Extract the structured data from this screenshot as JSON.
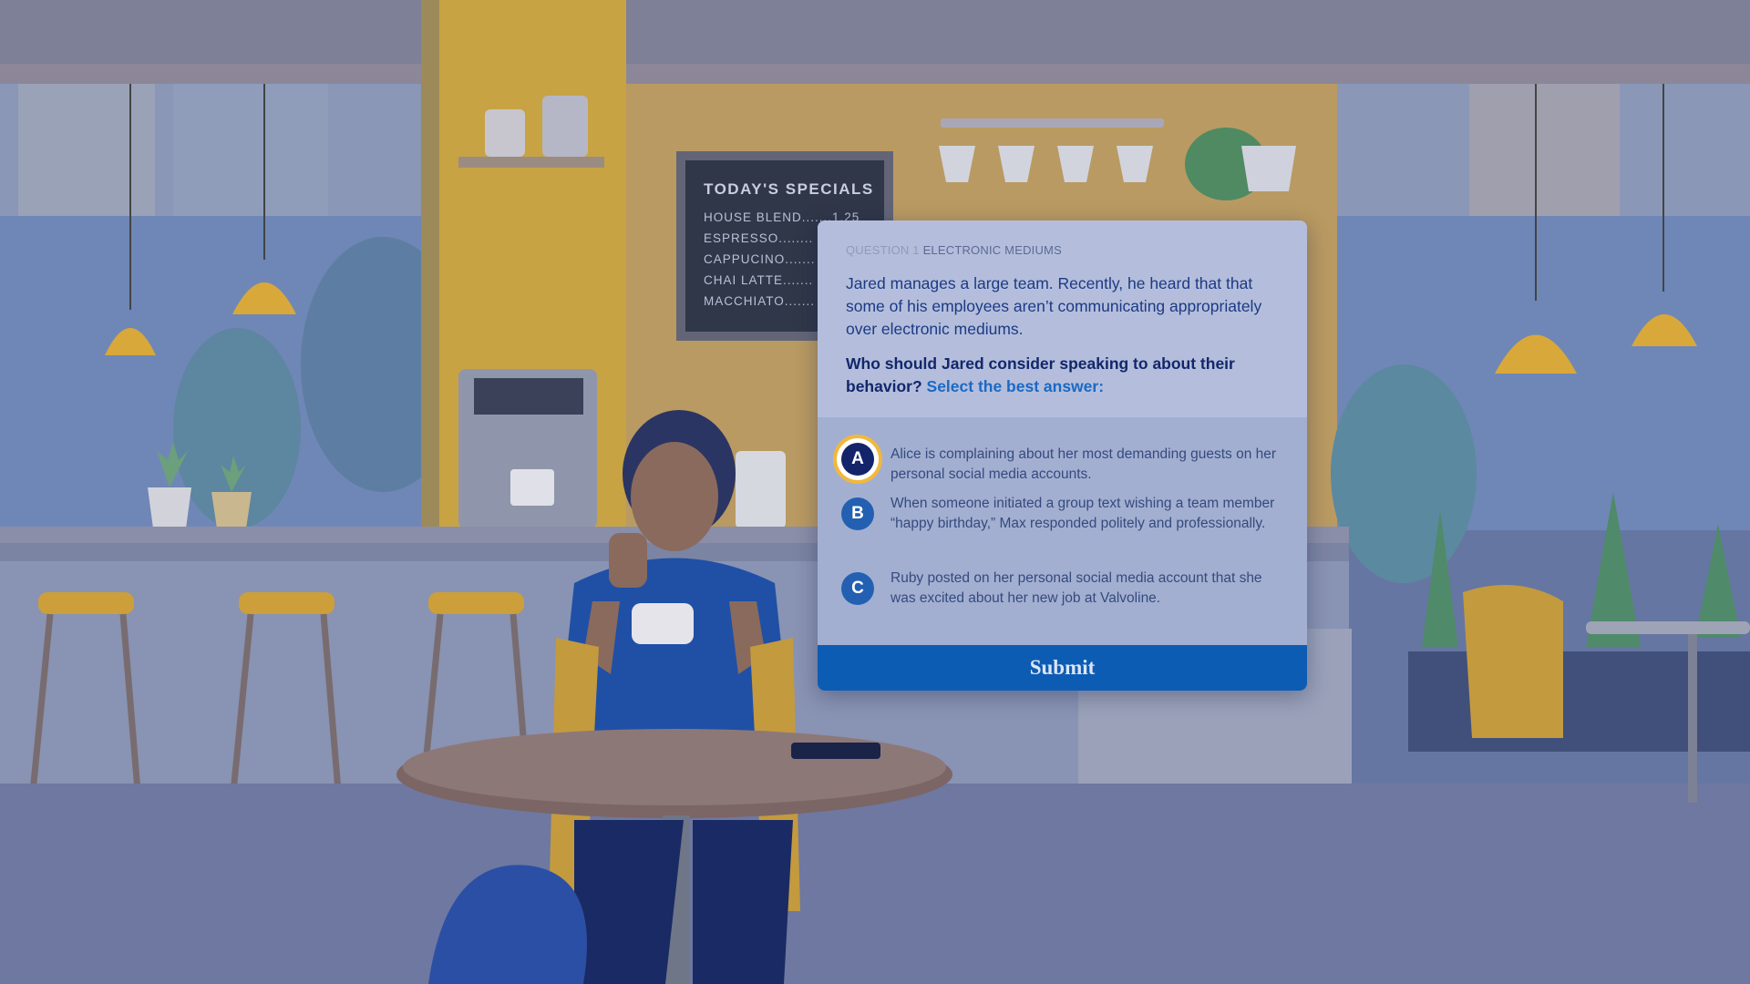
{
  "colors": {
    "overlay": "#5a6a98",
    "card_top": "#b4bedc",
    "card_body": "#a3afd1",
    "selected_badge": "#13246a",
    "badge": "#2360b2",
    "selected_ring": "#f2b83c",
    "submit": "#0d5cb3",
    "prompt_hint": "#1b69c4"
  },
  "background": {
    "board": {
      "title": "TODAY'S SPECIALS",
      "items": [
        "HOUSE BLEND.......1.25",
        "ESPRESSO........",
        "CAPPUCINO.......",
        "CHAI LATTE.......",
        "MACCHIATO......."
      ]
    }
  },
  "question": {
    "number_label": "QUESTION 1",
    "topic": "ELECTRONIC MEDIUMS",
    "scenario": "Jared manages a large team. Recently, he heard that that some of his employees aren’t communicating appropriately over electronic mediums.",
    "prompt": "Who should Jared consider speaking to about their behavior?",
    "instruction": "Select the best answer:",
    "options": [
      {
        "letter": "A",
        "text": "Alice is complaining about her most demanding guests on her personal social media accounts.",
        "selected": true
      },
      {
        "letter": "B",
        "text": "When someone initiated a group text wishing a team member “happy birthday,” Max responded politely and professionally.",
        "selected": false
      },
      {
        "letter": "C",
        "text": "Ruby posted on her personal social media account that she was excited about her new job at Valvoline.",
        "selected": false
      }
    ],
    "submit_label": "Submit"
  }
}
